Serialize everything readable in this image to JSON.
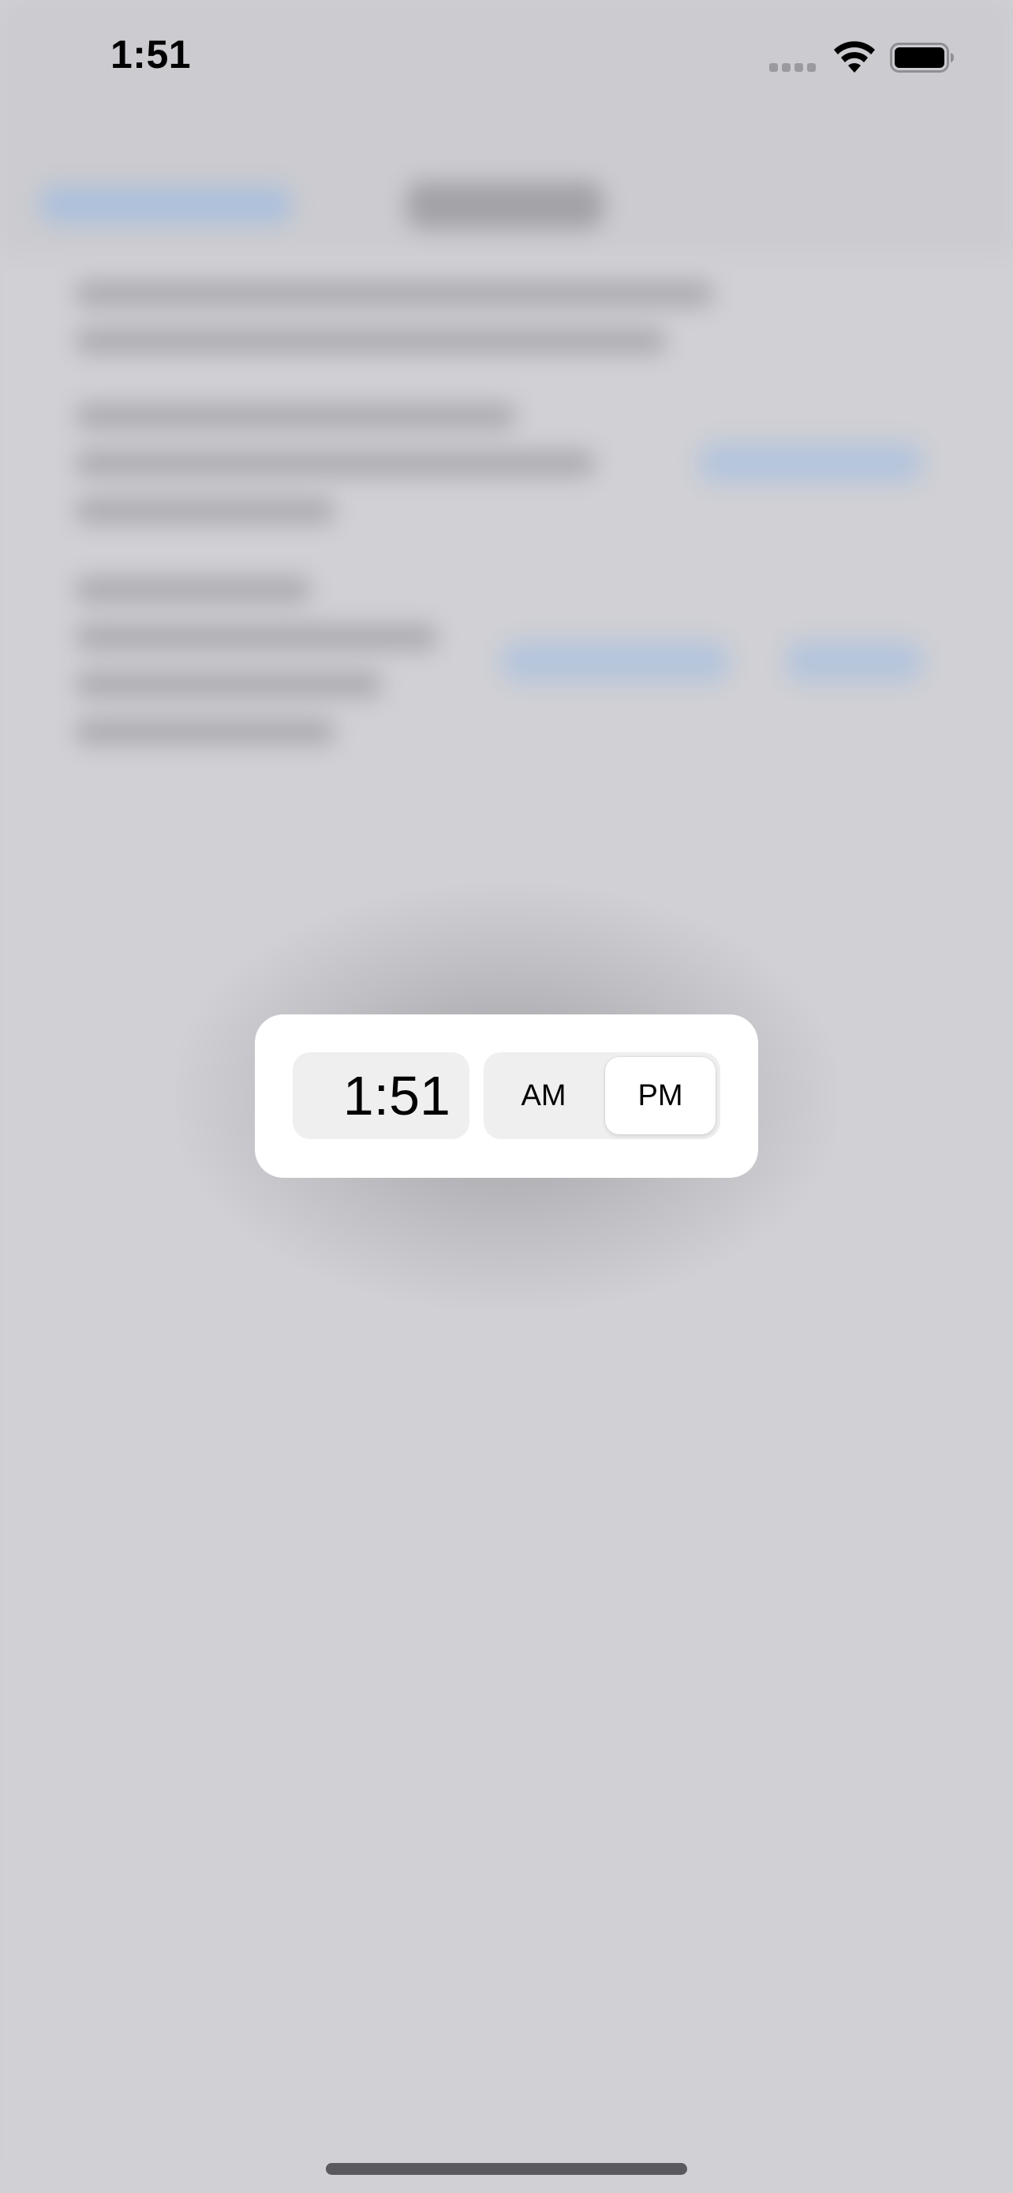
{
  "status_bar": {
    "time": "1:51",
    "signal_icon": "cellular-signal-icon",
    "wifi_icon": "wifi-icon",
    "battery_icon": "battery-full-icon"
  },
  "time_picker": {
    "time_value": "1:51",
    "am_label": "AM",
    "pm_label": "PM",
    "selected_period": "PM"
  },
  "colors": {
    "background": "#cfcfd4",
    "popover": "#ffffff",
    "field": "#efeff0",
    "blurred_accent": "#9ab8de"
  }
}
